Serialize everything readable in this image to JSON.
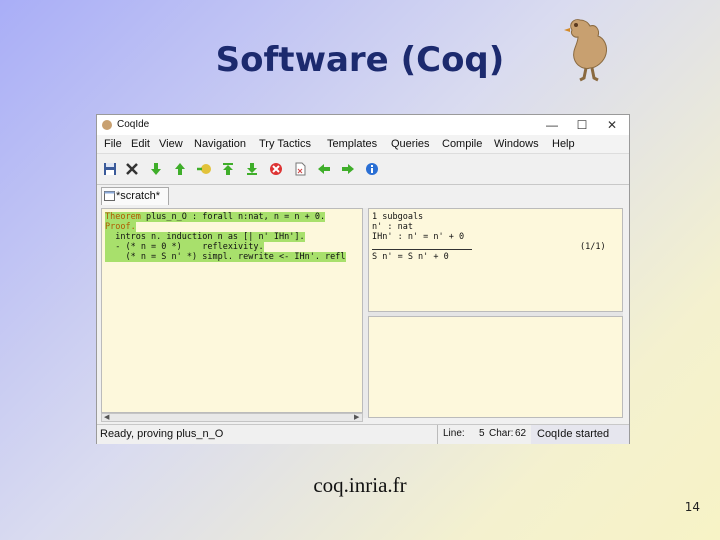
{
  "slide": {
    "title": "Software (Coq)",
    "caption": "coq.inria.fr",
    "page_number": "14"
  },
  "window": {
    "title": "CoqIde",
    "controls": [
      "—",
      "☐",
      "✕"
    ]
  },
  "menu": [
    "File",
    "Edit",
    "View",
    "Navigation",
    "Try Tactics",
    "Templates",
    "Queries",
    "Compile",
    "Windows",
    "Help"
  ],
  "toolbar_icons": [
    "save-icon",
    "close-icon",
    "arrow-down-icon",
    "arrow-up-icon",
    "interpret-icon",
    "goto-top-icon",
    "goto-end-icon",
    "stop-icon",
    "document-icon",
    "arrow-left-icon",
    "arrow-right-icon",
    "info-icon"
  ],
  "tab": {
    "label": "*scratch*"
  },
  "editor_lines": [
    {
      "kw": "Theorem",
      "rest": " plus_n_O : forall n:nat, n = n + 0."
    },
    {
      "kw": "Proof.",
      "rest": ""
    },
    {
      "kw": "",
      "rest": "  intros n. induction n as [| n' IHn']."
    },
    {
      "kw": "",
      "rest": "  - (* n = 0 *)    reflexivity."
    },
    {
      "kw": "",
      "rest": "    (* n = S n' *) simpl. rewrite <- IHn'. refl"
    }
  ],
  "goals": {
    "count_line": "1 subgoals",
    "hyp1": "n' : nat",
    "hyp2": "IHn' : n' = n' + 0",
    "counter": "(1/1)",
    "conclusion": "S n' = S n' + 0"
  },
  "status": {
    "message": "Ready, proving plus_n_O",
    "line_label": "Line:",
    "line_value": "5",
    "char_label": "Char:",
    "char_value": "62",
    "right_message": "CoqIde started"
  },
  "colors": {
    "title": "#1c2a6e",
    "highlight": "#a8e06c",
    "editor_bg": "#fdf8dc"
  }
}
